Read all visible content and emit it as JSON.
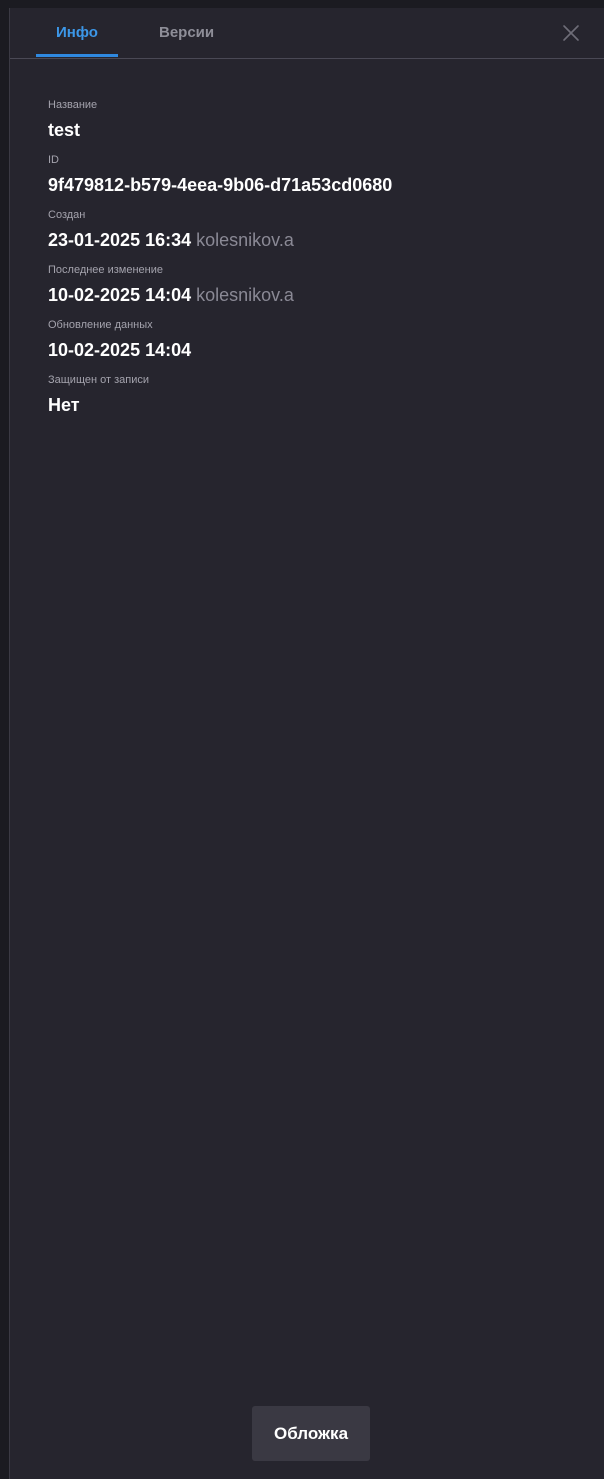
{
  "tabs": {
    "info": "Инфо",
    "versions": "Версии"
  },
  "fields": {
    "name": {
      "label": "Название",
      "value": "test"
    },
    "id": {
      "label": "ID",
      "value": "9f479812-b579-4eea-9b06-d71a53cd0680"
    },
    "created": {
      "label": "Создан",
      "value": "23-01-2025 16:34",
      "user": "kolesnikov.a"
    },
    "modified": {
      "label": "Последнее изменение",
      "value": "10-02-2025 14:04",
      "user": "kolesnikov.a"
    },
    "data_update": {
      "label": "Обновление данных",
      "value": "10-02-2025 14:04"
    },
    "write_protected": {
      "label": "Защищен от записи",
      "value": "Нет"
    }
  },
  "footer": {
    "cover_button": "Обложка"
  },
  "icons": {
    "close": "close-icon"
  },
  "colors": {
    "background": "#26252e",
    "accent": "#2f89e0",
    "active_tab": "#3c97e8",
    "inactive_tab": "#8e8e98",
    "label": "#a4a3ad",
    "value": "#ffffff",
    "user": "#8a8995",
    "button_bg": "#3a3943"
  }
}
